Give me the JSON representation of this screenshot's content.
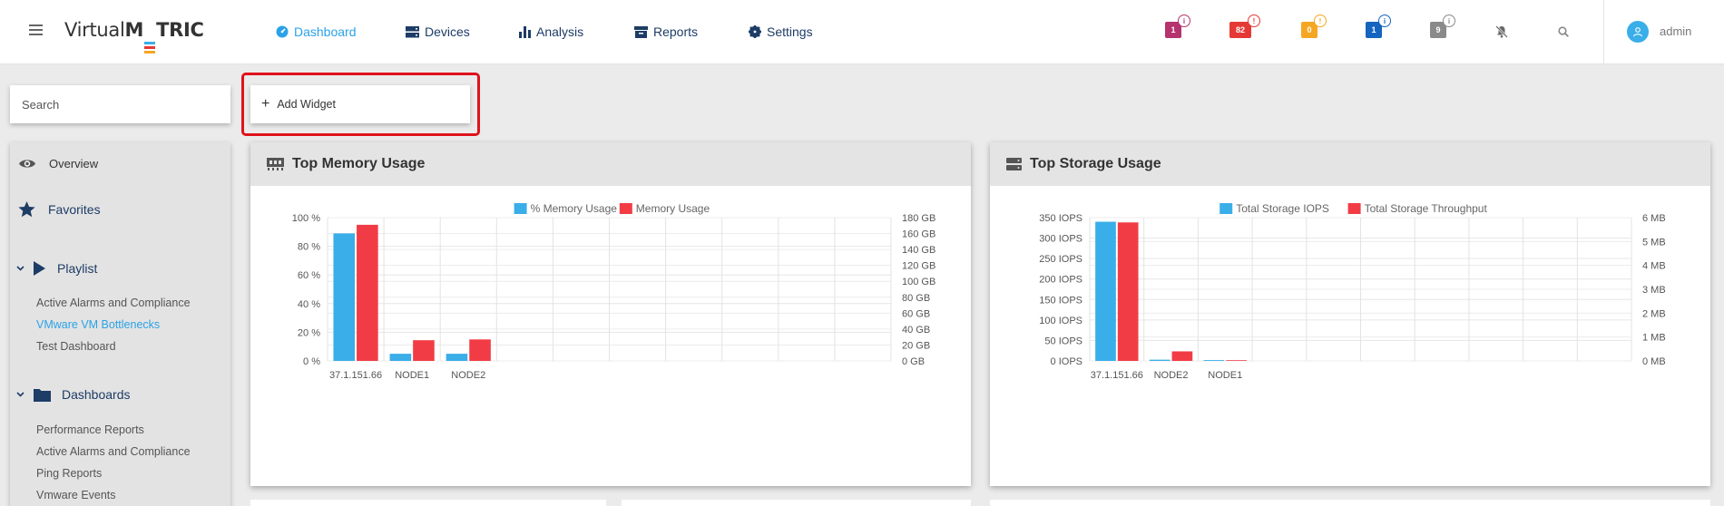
{
  "header": {
    "logo_prefix": "Virtual",
    "logo_m": "M",
    "logo_suffix": "TRIC",
    "nav": [
      {
        "label": "Dashboard",
        "icon": "dashboard-icon",
        "active": true
      },
      {
        "label": "Devices",
        "icon": "devices-icon",
        "active": false
      },
      {
        "label": "Analysis",
        "icon": "analysis-icon",
        "active": false
      },
      {
        "label": "Reports",
        "icon": "reports-icon",
        "active": false
      },
      {
        "label": "Settings",
        "icon": "settings-icon",
        "active": false
      }
    ],
    "alerts": [
      {
        "count": "1",
        "color": "#b5336e",
        "dot_color": "#b5336e",
        "dot": "i"
      },
      {
        "count": "82",
        "color": "#e53935",
        "dot_color": "#e53935",
        "dot": "!"
      },
      {
        "count": "0",
        "color": "#f5a623",
        "dot_color": "#f5a623",
        "dot": "!"
      },
      {
        "count": "1",
        "color": "#1565c0",
        "dot_color": "#1565c0",
        "dot": "i"
      },
      {
        "count": "9",
        "color": "#8a8a8a",
        "dot_color": "#8a8a8a",
        "dot": "i"
      }
    ],
    "user": "admin"
  },
  "search": {
    "placeholder": "Search"
  },
  "add_widget": {
    "label": "Add Widget"
  },
  "sidebar": {
    "overview": "Overview",
    "favorites": "Favorites",
    "playlist": {
      "label": "Playlist",
      "items": [
        "Active Alarms and Compliance",
        "VMware VM Bottlenecks",
        "Test Dashboard"
      ],
      "active_index": 1
    },
    "dashboards": {
      "label": "Dashboards",
      "items": [
        "Performance Reports",
        "Active Alarms and Compliance",
        "Ping Reports",
        "Vmware Events"
      ]
    }
  },
  "colors": {
    "series_blue": "#3aaee8",
    "series_red": "#f23c45",
    "accent": "#2aa2e8",
    "nav_text": "#1d3c66"
  },
  "widgets": [
    {
      "title": "Top Memory Usage",
      "icon": "memory-icon"
    },
    {
      "title": "Top Storage Usage",
      "icon": "storage-icon"
    }
  ],
  "chart_data": [
    {
      "type": "bar",
      "title": "Top Memory Usage",
      "categories": [
        "37.1.151.66",
        "NODE1",
        "NODE2"
      ],
      "series": [
        {
          "name": "% Memory Usage",
          "axis": "left",
          "values": [
            89,
            5,
            5
          ]
        },
        {
          "name": "Memory Usage",
          "axis": "right",
          "values": [
            171,
            26,
            27
          ]
        }
      ],
      "slots": 10,
      "ylim": [
        0,
        100
      ],
      "y_ticks": [
        "0 %",
        "20 %",
        "40 %",
        "60 %",
        "80 %",
        "100 %"
      ],
      "y2lim": [
        0,
        180
      ],
      "y2_ticks": [
        "0 GB",
        "20 GB",
        "40 GB",
        "60 GB",
        "80 GB",
        "100 GB",
        "120 GB",
        "140 GB",
        "160 GB",
        "180 GB"
      ],
      "legend": "top-center",
      "grid": true
    },
    {
      "type": "bar",
      "title": "Top Storage Usage",
      "categories": [
        "37.1.151.66",
        "NODE2",
        "NODE1"
      ],
      "series": [
        {
          "name": "Total Storage IOPS",
          "axis": "left",
          "values": [
            340,
            3,
            2
          ]
        },
        {
          "name": "Total Storage Throughput",
          "axis": "right",
          "values": [
            5.8,
            0.4,
            0.03
          ]
        }
      ],
      "slots": 10,
      "ylim": [
        0,
        350
      ],
      "y_ticks": [
        "0 IOPS",
        "50 IOPS",
        "100 IOPS",
        "150 IOPS",
        "200 IOPS",
        "250 IOPS",
        "300 IOPS",
        "350 IOPS"
      ],
      "y2lim": [
        0,
        6
      ],
      "y2_ticks": [
        "0 MB",
        "1 MB",
        "2 MB",
        "3 MB",
        "4 MB",
        "5 MB",
        "6 MB"
      ],
      "legend": "top-center",
      "grid": true
    }
  ]
}
